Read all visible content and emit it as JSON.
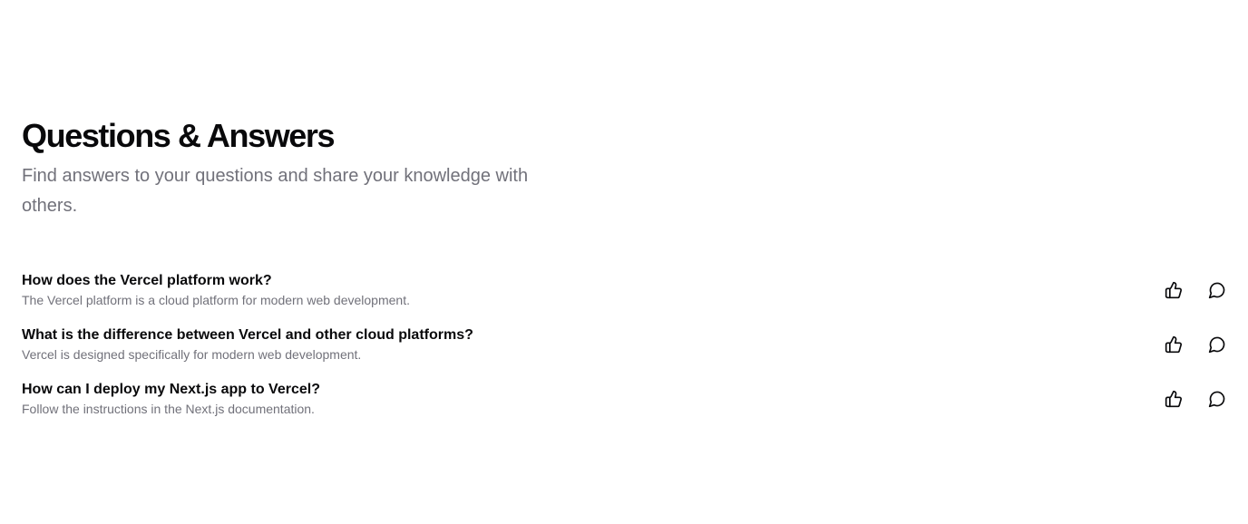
{
  "header": {
    "title": "Questions & Answers",
    "subtitle": "Find answers to your questions and share your knowledge with others."
  },
  "questions": [
    {
      "question": "How does the Vercel platform work?",
      "answer": "The Vercel platform is a cloud platform for modern web development."
    },
    {
      "question": "What is the difference between Vercel and other cloud platforms?",
      "answer": "Vercel is designed specifically for modern web development."
    },
    {
      "question": "How can I deploy my Next.js app to Vercel?",
      "answer": "Follow the instructions in the Next.js documentation."
    }
  ],
  "icons": {
    "like": "thumbs-up-icon",
    "comment": "message-circle-icon"
  },
  "colors": {
    "heading": "#09090b",
    "muted": "#71717a",
    "background": "#ffffff"
  }
}
